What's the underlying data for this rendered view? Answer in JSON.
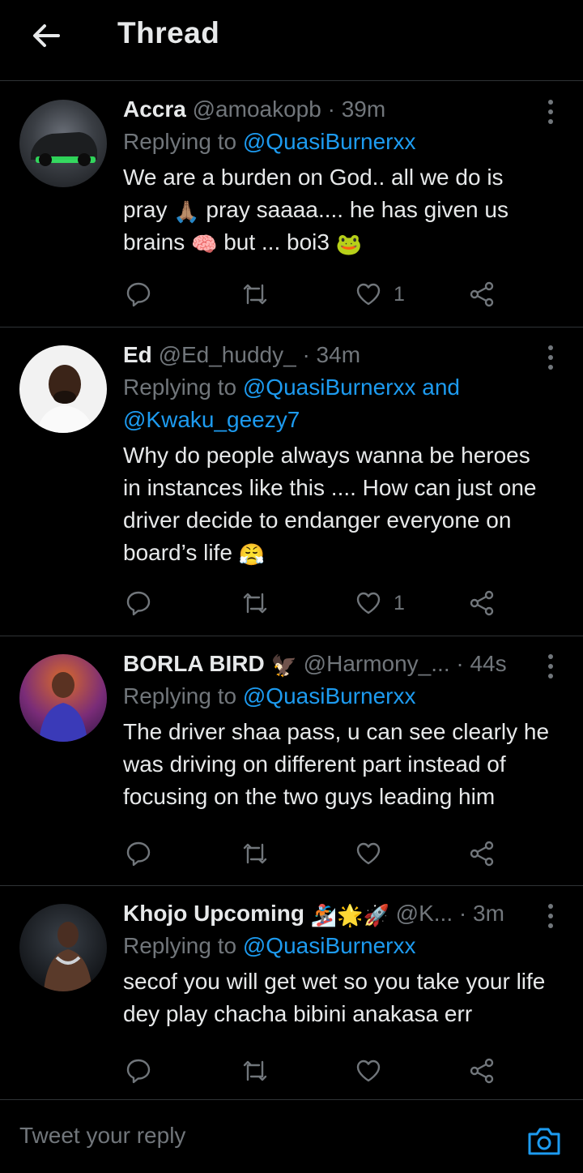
{
  "header": {
    "title": "Thread"
  },
  "tweets": [
    {
      "name": "Accra",
      "handle": "@amoakopb",
      "time": "· 39m",
      "replying_prefix": "Replying to ",
      "mentions": "@QuasiBurnerxx",
      "text1": "We are a burden on God.. all we do is pray ",
      "text2": " pray saaaa.... he has given us brains ",
      "text3": " but ... boi3 ",
      "emojis": [
        "🙏🏽",
        "🧠",
        "🐸"
      ],
      "likes": "1"
    },
    {
      "name": "Ed",
      "handle": "@Ed_huddy_",
      "time": "· 34m",
      "replying_prefix": "Replying to ",
      "mentions": "@QuasiBurnerxx and @Kwaku_geezy7",
      "text1": "Why do people always wanna be heroes in instances like this .... How can just one driver decide to endanger everyone on board’s life ",
      "emojis": [
        "😤"
      ],
      "likes": "1"
    },
    {
      "name": "BORLA BIRD",
      "name_emoji": "🦅",
      "handle": "@Harmony_...",
      "time": "· 44s",
      "replying_prefix": "Replying to ",
      "mentions": "@QuasiBurnerxx",
      "text1": "The driver shaa pass, u can see clearly he was driving on different part  instead of focusing on the two guys leading him",
      "likes": ""
    },
    {
      "name": "Khojo Upcoming",
      "name_emoji": "🏂🌟🚀",
      "handle": "@K...",
      "time": "· 3m",
      "replying_prefix": "Replying to ",
      "mentions": "@QuasiBurnerxx",
      "text1": "secof you will get wet so you take your life dey play chacha bibini anakasa err",
      "likes": ""
    }
  ],
  "composer": {
    "placeholder": "Tweet your reply"
  },
  "colors": {
    "background": "#000000",
    "link": "#1d9bf0",
    "muted": "#71767b",
    "text": "#e7e9ea",
    "divider": "#2f3336"
  },
  "icons": [
    "back-arrow-icon",
    "more-dots-icon",
    "reply-icon",
    "retweet-icon",
    "like-icon",
    "share-icon",
    "camera-icon"
  ]
}
